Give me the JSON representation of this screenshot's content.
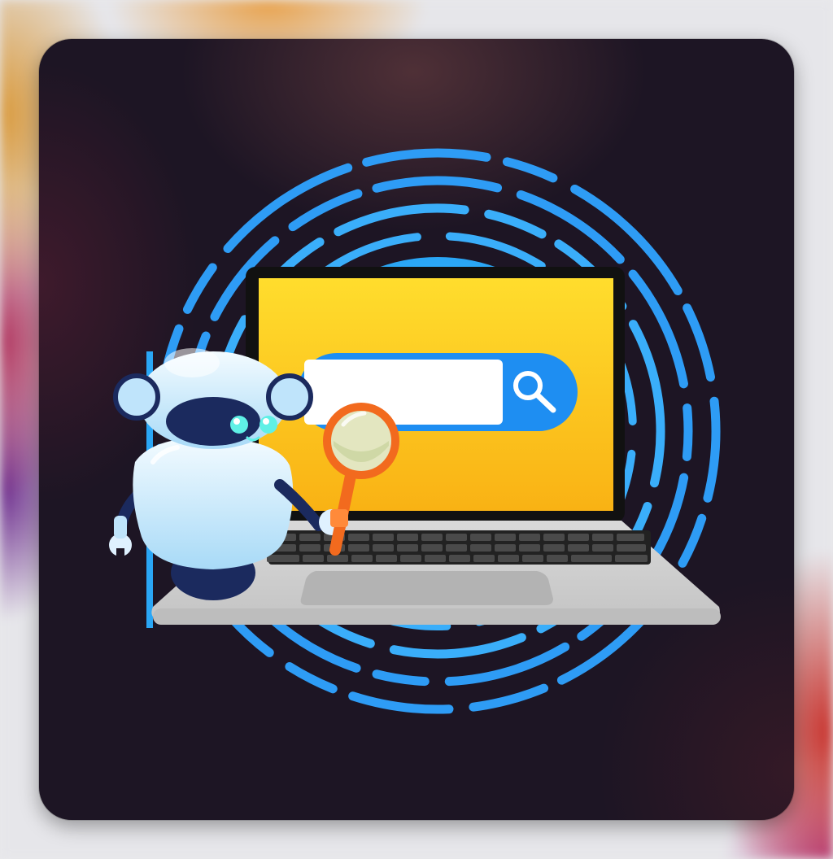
{
  "colors": {
    "ring": "#2f9cf4",
    "ring_light": "#3ec4ff",
    "screen_top": "#ffd92a",
    "screen_bottom": "#fbb715",
    "laptop_body": "#cfcfcf",
    "search_button": "#1e8cf0",
    "magnifier_rim": "#f26a1e",
    "robot_body": "#dff1ff",
    "robot_dark": "#1b2a5e",
    "card_bg": "#1d1524"
  },
  "icons": {
    "search": "search-icon",
    "magnifier": "magnifying-glass-icon",
    "robot": "robot-mascot-icon"
  }
}
